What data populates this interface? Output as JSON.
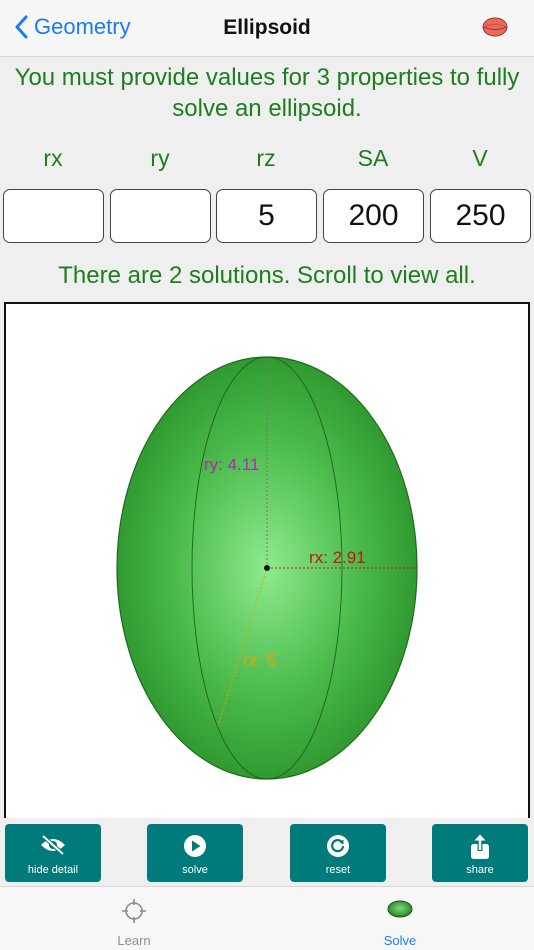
{
  "nav": {
    "back_label": "Geometry",
    "title": "Ellipsoid"
  },
  "info_message": "You must provide values for 3 properties to fully solve an ellipsoid.",
  "fields": [
    {
      "label": "rx",
      "value": ""
    },
    {
      "label": "ry",
      "value": ""
    },
    {
      "label": "rz",
      "value": "5"
    },
    {
      "label": "SA",
      "value": "200"
    },
    {
      "label": "V",
      "value": "250"
    }
  ],
  "status_message": "There are 2 solutions. Scroll to view all.",
  "diagram": {
    "rx_label": "rx: 2.91",
    "ry_label": "ry: 4.11",
    "rz_label": "rz: 5",
    "colors": {
      "rx": "#cc1111",
      "ry": "#b02ab0",
      "rz": "#e8a000",
      "body": "#2e9b2e"
    }
  },
  "toolbar": {
    "hide_detail": "hide detail",
    "solve": "solve",
    "reset": "reset",
    "share": "share"
  },
  "tabs": {
    "learn": "Learn",
    "solve": "Solve",
    "active_color": "#1a7cf5",
    "inactive_color": "#8e8e8e"
  }
}
